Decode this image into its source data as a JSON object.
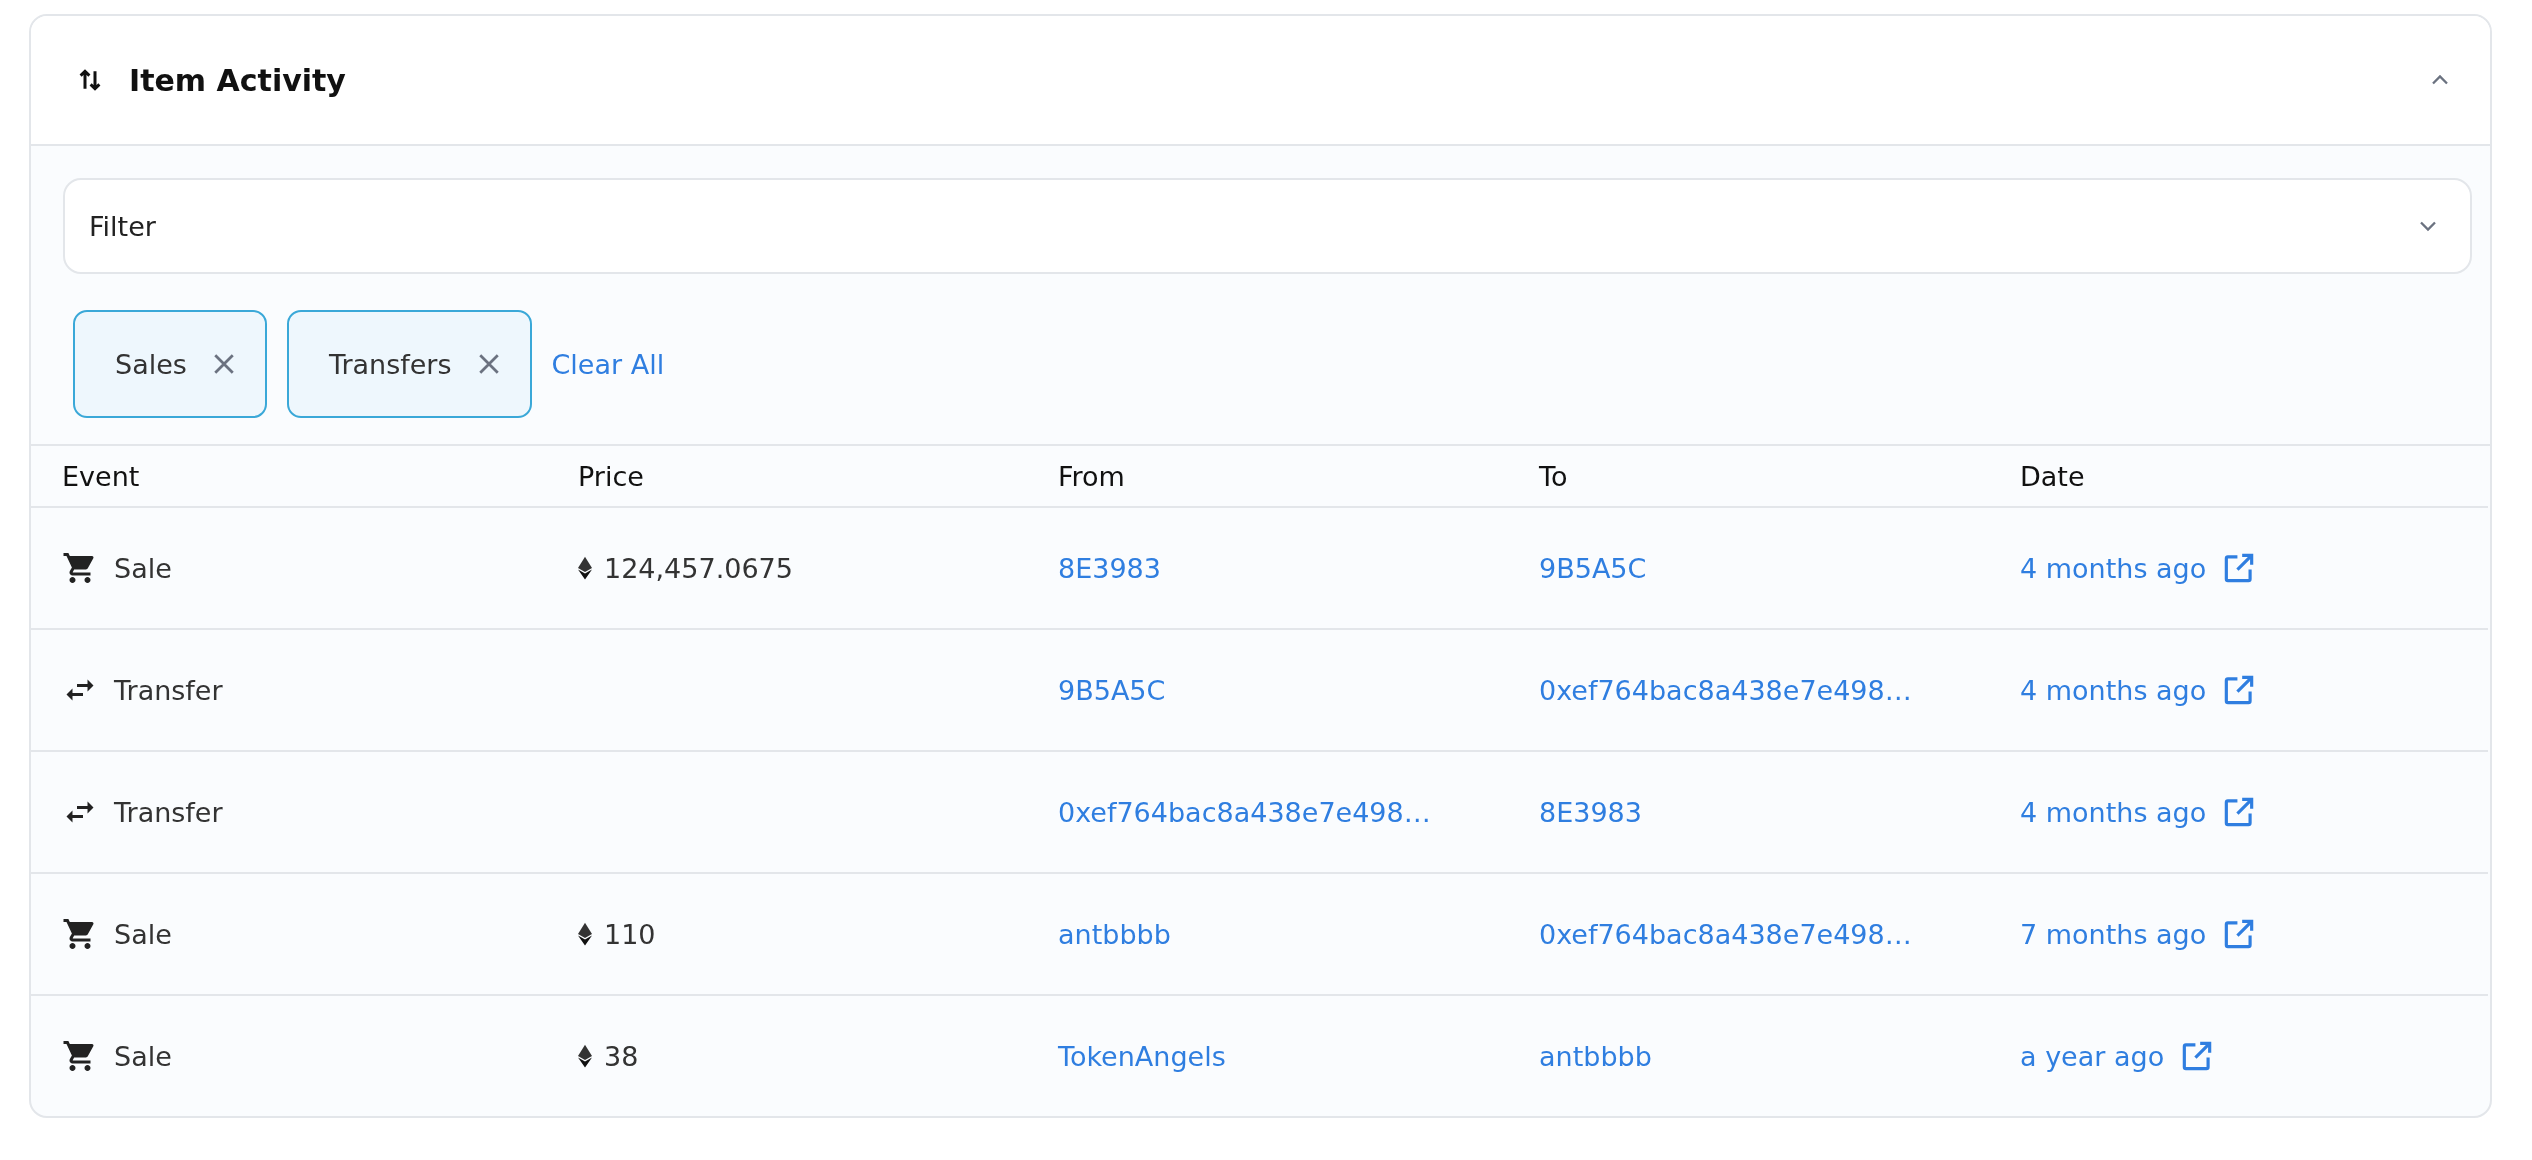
{
  "panel": {
    "title": "Item Activity",
    "expanded": true
  },
  "filter": {
    "placeholder": "Filter"
  },
  "chips": [
    {
      "label": "Sales"
    },
    {
      "label": "Transfers"
    }
  ],
  "clear_all": "Clear All",
  "table": {
    "columns": [
      "Event",
      "Price",
      "From",
      "To",
      "Date"
    ],
    "rows": [
      {
        "kind": "sale",
        "event": "Sale",
        "price": "124,457.0675",
        "from": "8E3983",
        "to": "9B5A5C",
        "date": "4 months ago"
      },
      {
        "kind": "transfer",
        "event": "Transfer",
        "price": "",
        "from": "9B5A5C",
        "to": "0xef764bac8a438e7e498…",
        "date": "4 months ago"
      },
      {
        "kind": "transfer",
        "event": "Transfer",
        "price": "",
        "from": "0xef764bac8a438e7e498…",
        "to": "8E3983",
        "date": "4 months ago"
      },
      {
        "kind": "sale",
        "event": "Sale",
        "price": "110",
        "from": "antbbbb",
        "to": "0xef764bac8a438e7e498…",
        "date": "7 months ago"
      },
      {
        "kind": "sale",
        "event": "Sale",
        "price": "38",
        "from": "TokenAngels",
        "to": "antbbbb",
        "date": "a year ago"
      }
    ]
  }
}
